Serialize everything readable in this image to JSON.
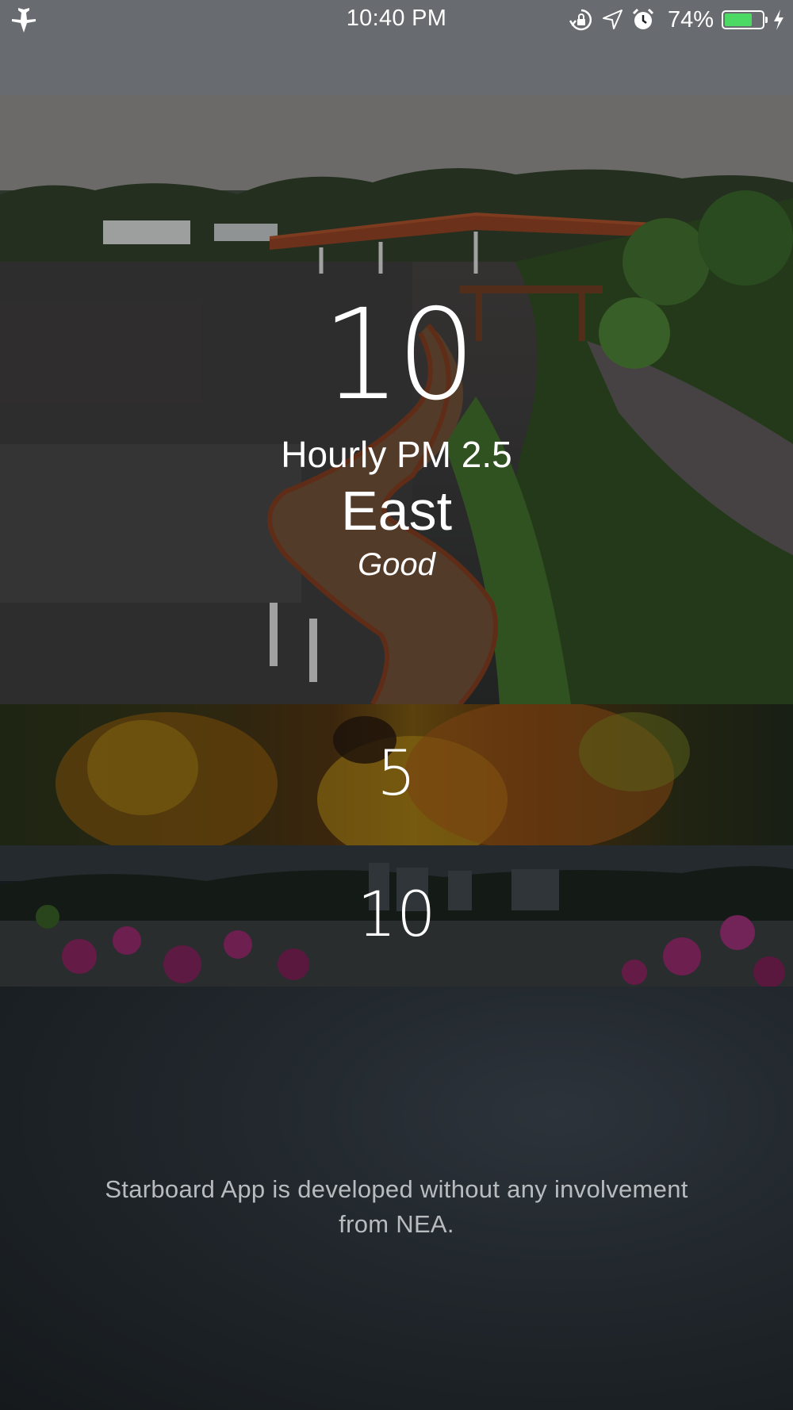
{
  "status_bar": {
    "time": "10:40 PM",
    "battery_percent": "74%",
    "battery_level": 0.74,
    "icons": [
      "airplane-icon",
      "orientation-lock-icon",
      "location-arrow-icon",
      "alarm-icon",
      "battery-icon",
      "charging-bolt-icon"
    ],
    "battery_color": "#4cd964"
  },
  "hero": {
    "value": "10",
    "metric": "Hourly PM 2.5",
    "region": "East",
    "status": "Good"
  },
  "panels": [
    {
      "value": "5"
    },
    {
      "value": "10"
    }
  ],
  "footer": {
    "disclaimer": "Starboard App is developed without any involvement from NEA."
  }
}
